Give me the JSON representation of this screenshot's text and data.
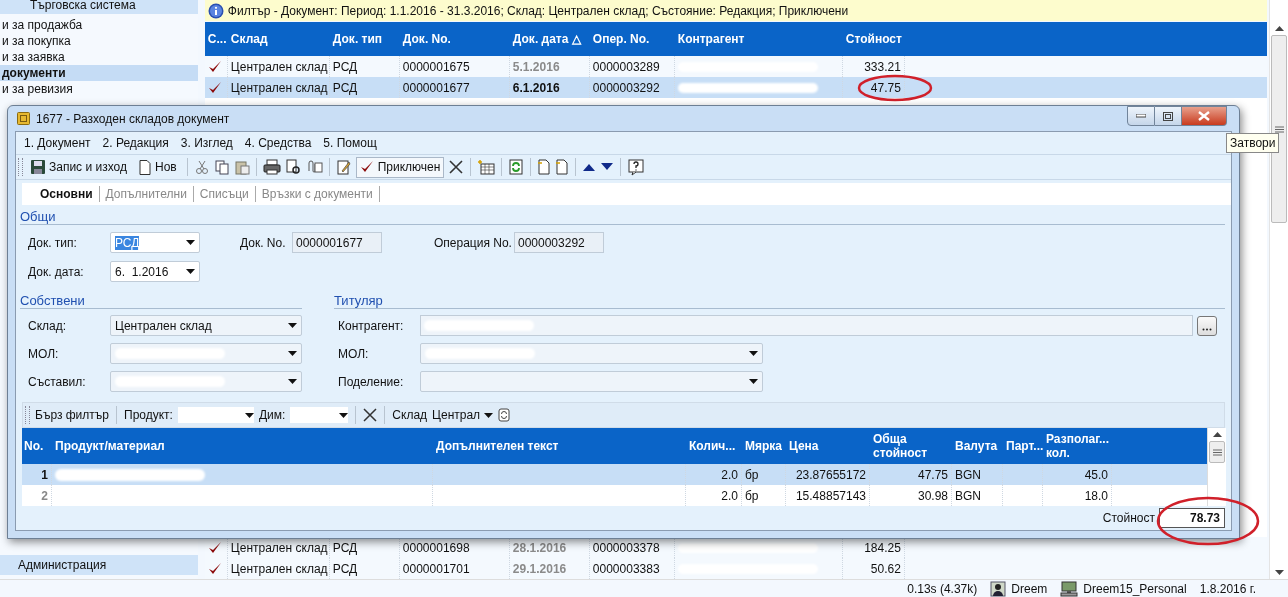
{
  "sidebar": {
    "header": "Търговска система",
    "items": [
      {
        "label": "и за продажба",
        "selected": false
      },
      {
        "label": "и за покупка",
        "selected": false
      },
      {
        "label": "и за заявка",
        "selected": false
      },
      {
        "label": "документи",
        "selected": true
      },
      {
        "label": "и за ревизия",
        "selected": false
      }
    ],
    "bottom_items": [
      {
        "label": "Администрация",
        "selected": false
      }
    ]
  },
  "filter_bar": {
    "text": "Филтър - Документ: Период: 1.1.2016 - 31.3.2016; Склад: Централен склад; Състояние: Редакция; Приключени"
  },
  "documents_table": {
    "columns": [
      "С...",
      "Склад",
      "Док. тип",
      "Док. No.",
      "Док. дата △",
      "Опер. No.",
      "Контрагент",
      "Стойност"
    ],
    "rows": [
      {
        "checked": true,
        "selected": false,
        "warehouse": "Централен склад",
        "doc_type": "РСД",
        "doc_no": "0000001675",
        "doc_date": "5.1.2016",
        "oper_no": "0000003289",
        "value": "333.21"
      },
      {
        "checked": true,
        "selected": true,
        "warehouse": "Централен склад",
        "doc_type": "РСД",
        "doc_no": "0000001677",
        "doc_date": "6.1.2016",
        "oper_no": "0000003292",
        "value": "47.75"
      }
    ],
    "bottom_rows": [
      {
        "checked": true,
        "selected": false,
        "warehouse": "Централен склад",
        "doc_type": "РСД",
        "doc_no": "0000001698",
        "doc_date": "28.1.2016",
        "oper_no": "0000003378",
        "value": "184.25"
      },
      {
        "checked": true,
        "selected": false,
        "warehouse": "Централен склад",
        "doc_type": "РСД",
        "doc_no": "0000001701",
        "doc_date": "29.1.2016",
        "oper_no": "0000003383",
        "value": "50.62"
      }
    ]
  },
  "dialog": {
    "title": "1677 - Разходен складов документ",
    "tooltip": "Затвори",
    "menu": [
      "1. Документ",
      "2. Редакция",
      "3. Изглед",
      "4. Средства",
      "5. Помощ"
    ],
    "toolbar": {
      "save_label": "Запис и изход",
      "new_label": "Нов",
      "finished": {
        "label": "Приключен",
        "on": true
      }
    },
    "tabs": [
      {
        "label": "Основни",
        "selected": true
      },
      {
        "label": "Допълнителни",
        "selected": false
      },
      {
        "label": "Списъци",
        "selected": false
      },
      {
        "label": "Връзки с документи",
        "selected": false
      }
    ],
    "general": {
      "heading": "Общи",
      "doc_type": {
        "label": "Док. тип:",
        "value": "РСД"
      },
      "doc_no": {
        "label": "Док. No.",
        "value": "0000001677"
      },
      "operation_no": {
        "label": "Операция No.",
        "value": "0000003292"
      },
      "doc_date": {
        "label": "Док. дата:",
        "value": "6.  1.2016"
      }
    },
    "own": {
      "heading": "Собствени",
      "fields": [
        {
          "label": "Склад:",
          "value": "Централен склад"
        },
        {
          "label": "МОЛ:"
        },
        {
          "label": "Съставил:"
        }
      ]
    },
    "holder": {
      "heading": "Титуляр",
      "fields": [
        {
          "kind": "lookup",
          "label": "Контрагент:"
        },
        {
          "kind": "dropdown",
          "label": "МОЛ:"
        },
        {
          "kind": "dropdown",
          "label": "Поделение:"
        }
      ]
    },
    "quick_filter": {
      "label": "Бърз филтър",
      "product_label": "Продукт:",
      "dim_label": "Дим:",
      "warehouse_label": "Склад",
      "warehouse_value": "Централ"
    },
    "grid": {
      "columns": [
        "No.",
        "Продукт/материал",
        "Допълнителен текст",
        "Колич...",
        "Мярка",
        "Цена",
        "Обща стойност",
        "Валута",
        "Парт...",
        "Разполаг... кол."
      ],
      "rows": [
        {
          "no": "1",
          "selected": true,
          "qty": "2.0",
          "unit": "бр",
          "price": "23.87655172",
          "total": "47.75",
          "currency": "BGN",
          "available": "45.0"
        },
        {
          "no": "2",
          "selected": false,
          "qty": "2.0",
          "unit": "бр",
          "price": "15.48857143",
          "total": "30.98",
          "currency": "BGN",
          "available": "18.0"
        }
      ]
    },
    "total": {
      "label": "Стойност",
      "value": "78.73"
    }
  },
  "status_bar": {
    "timing": "0.13s (4.37k)",
    "user": "Dreem",
    "database": "Dreem15_Personal",
    "date": "1.8.2016 г."
  }
}
